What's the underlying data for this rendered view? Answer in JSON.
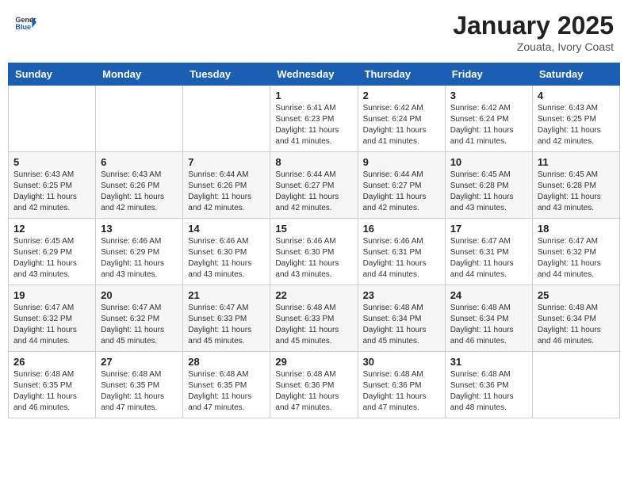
{
  "header": {
    "logo_general": "General",
    "logo_blue": "Blue",
    "title": "January 2025",
    "subtitle": "Zouata, Ivory Coast"
  },
  "weekdays": [
    "Sunday",
    "Monday",
    "Tuesday",
    "Wednesday",
    "Thursday",
    "Friday",
    "Saturday"
  ],
  "weeks": [
    [
      {
        "day": "",
        "info": ""
      },
      {
        "day": "",
        "info": ""
      },
      {
        "day": "",
        "info": ""
      },
      {
        "day": "1",
        "info": "Sunrise: 6:41 AM\nSunset: 6:23 PM\nDaylight: 11 hours and 41 minutes."
      },
      {
        "day": "2",
        "info": "Sunrise: 6:42 AM\nSunset: 6:24 PM\nDaylight: 11 hours and 41 minutes."
      },
      {
        "day": "3",
        "info": "Sunrise: 6:42 AM\nSunset: 6:24 PM\nDaylight: 11 hours and 41 minutes."
      },
      {
        "day": "4",
        "info": "Sunrise: 6:43 AM\nSunset: 6:25 PM\nDaylight: 11 hours and 42 minutes."
      }
    ],
    [
      {
        "day": "5",
        "info": "Sunrise: 6:43 AM\nSunset: 6:25 PM\nDaylight: 11 hours and 42 minutes."
      },
      {
        "day": "6",
        "info": "Sunrise: 6:43 AM\nSunset: 6:26 PM\nDaylight: 11 hours and 42 minutes."
      },
      {
        "day": "7",
        "info": "Sunrise: 6:44 AM\nSunset: 6:26 PM\nDaylight: 11 hours and 42 minutes."
      },
      {
        "day": "8",
        "info": "Sunrise: 6:44 AM\nSunset: 6:27 PM\nDaylight: 11 hours and 42 minutes."
      },
      {
        "day": "9",
        "info": "Sunrise: 6:44 AM\nSunset: 6:27 PM\nDaylight: 11 hours and 42 minutes."
      },
      {
        "day": "10",
        "info": "Sunrise: 6:45 AM\nSunset: 6:28 PM\nDaylight: 11 hours and 43 minutes."
      },
      {
        "day": "11",
        "info": "Sunrise: 6:45 AM\nSunset: 6:28 PM\nDaylight: 11 hours and 43 minutes."
      }
    ],
    [
      {
        "day": "12",
        "info": "Sunrise: 6:45 AM\nSunset: 6:29 PM\nDaylight: 11 hours and 43 minutes."
      },
      {
        "day": "13",
        "info": "Sunrise: 6:46 AM\nSunset: 6:29 PM\nDaylight: 11 hours and 43 minutes."
      },
      {
        "day": "14",
        "info": "Sunrise: 6:46 AM\nSunset: 6:30 PM\nDaylight: 11 hours and 43 minutes."
      },
      {
        "day": "15",
        "info": "Sunrise: 6:46 AM\nSunset: 6:30 PM\nDaylight: 11 hours and 43 minutes."
      },
      {
        "day": "16",
        "info": "Sunrise: 6:46 AM\nSunset: 6:31 PM\nDaylight: 11 hours and 44 minutes."
      },
      {
        "day": "17",
        "info": "Sunrise: 6:47 AM\nSunset: 6:31 PM\nDaylight: 11 hours and 44 minutes."
      },
      {
        "day": "18",
        "info": "Sunrise: 6:47 AM\nSunset: 6:32 PM\nDaylight: 11 hours and 44 minutes."
      }
    ],
    [
      {
        "day": "19",
        "info": "Sunrise: 6:47 AM\nSunset: 6:32 PM\nDaylight: 11 hours and 44 minutes."
      },
      {
        "day": "20",
        "info": "Sunrise: 6:47 AM\nSunset: 6:32 PM\nDaylight: 11 hours and 45 minutes."
      },
      {
        "day": "21",
        "info": "Sunrise: 6:47 AM\nSunset: 6:33 PM\nDaylight: 11 hours and 45 minutes."
      },
      {
        "day": "22",
        "info": "Sunrise: 6:48 AM\nSunset: 6:33 PM\nDaylight: 11 hours and 45 minutes."
      },
      {
        "day": "23",
        "info": "Sunrise: 6:48 AM\nSunset: 6:34 PM\nDaylight: 11 hours and 45 minutes."
      },
      {
        "day": "24",
        "info": "Sunrise: 6:48 AM\nSunset: 6:34 PM\nDaylight: 11 hours and 46 minutes."
      },
      {
        "day": "25",
        "info": "Sunrise: 6:48 AM\nSunset: 6:34 PM\nDaylight: 11 hours and 46 minutes."
      }
    ],
    [
      {
        "day": "26",
        "info": "Sunrise: 6:48 AM\nSunset: 6:35 PM\nDaylight: 11 hours and 46 minutes."
      },
      {
        "day": "27",
        "info": "Sunrise: 6:48 AM\nSunset: 6:35 PM\nDaylight: 11 hours and 47 minutes."
      },
      {
        "day": "28",
        "info": "Sunrise: 6:48 AM\nSunset: 6:35 PM\nDaylight: 11 hours and 47 minutes."
      },
      {
        "day": "29",
        "info": "Sunrise: 6:48 AM\nSunset: 6:36 PM\nDaylight: 11 hours and 47 minutes."
      },
      {
        "day": "30",
        "info": "Sunrise: 6:48 AM\nSunset: 6:36 PM\nDaylight: 11 hours and 47 minutes."
      },
      {
        "day": "31",
        "info": "Sunrise: 6:48 AM\nSunset: 6:36 PM\nDaylight: 11 hours and 48 minutes."
      },
      {
        "day": "",
        "info": ""
      }
    ]
  ]
}
